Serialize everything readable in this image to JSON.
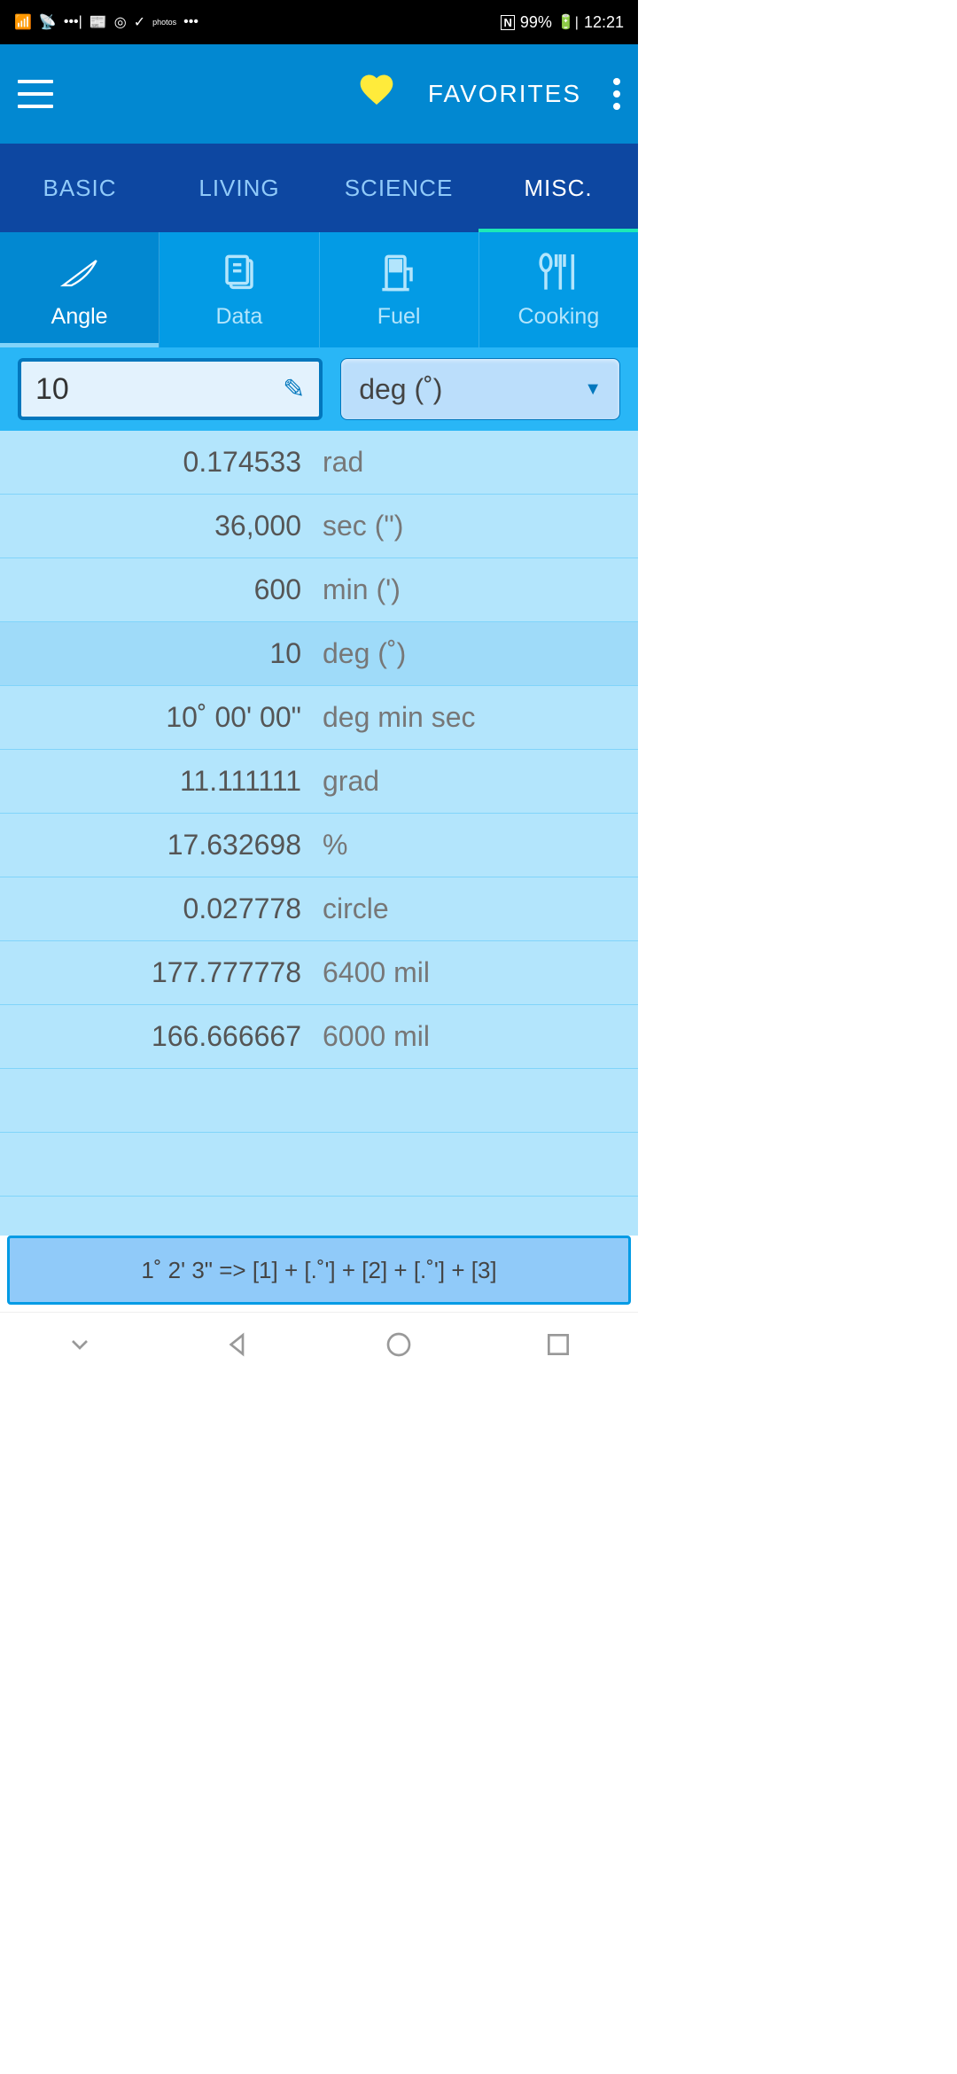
{
  "status": {
    "battery": "99%",
    "time": "12:21"
  },
  "appbar": {
    "favorites_label": "FAVORITES"
  },
  "main_tabs": [
    {
      "label": "BASIC",
      "active": false
    },
    {
      "label": "LIVING",
      "active": false
    },
    {
      "label": "SCIENCE",
      "active": false
    },
    {
      "label": "MISC.",
      "active": true
    }
  ],
  "sub_tabs": [
    {
      "label": "Angle",
      "active": true
    },
    {
      "label": "Data",
      "active": false
    },
    {
      "label": "Fuel",
      "active": false
    },
    {
      "label": "Cooking",
      "active": false
    }
  ],
  "input": {
    "value": "10",
    "selected_unit": "deg (˚)"
  },
  "results": [
    {
      "value": "0.174533",
      "unit": "rad",
      "highlight": false
    },
    {
      "value": "36,000",
      "unit": "sec (\")",
      "highlight": false
    },
    {
      "value": "600",
      "unit": "min (')",
      "highlight": false
    },
    {
      "value": "10",
      "unit": "deg (˚)",
      "highlight": true
    },
    {
      "value": "10˚ 00' 00\"",
      "unit": "deg min sec",
      "highlight": false
    },
    {
      "value": "11.111111",
      "unit": "grad",
      "highlight": false
    },
    {
      "value": "17.632698",
      "unit": "%",
      "highlight": false
    },
    {
      "value": "0.027778",
      "unit": "circle",
      "highlight": false
    },
    {
      "value": "177.777778",
      "unit": "6400 mil",
      "highlight": false
    },
    {
      "value": "166.666667",
      "unit": "6000 mil",
      "highlight": false
    }
  ],
  "hint": "1˚ 2' 3\" => [1] + [.˚'] + [2] + [.˚'] + [3]"
}
